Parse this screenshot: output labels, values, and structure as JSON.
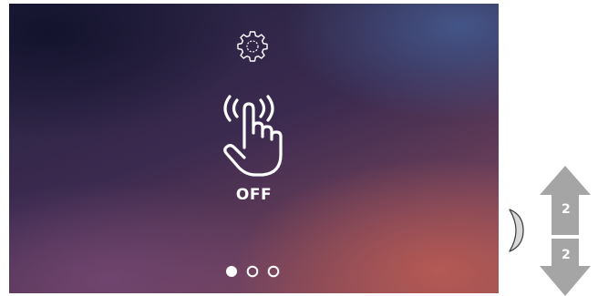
{
  "screen": {
    "status_label": "OFF",
    "icons": {
      "settings": "gear-icon",
      "function": "touch-hand-icon"
    },
    "pagination": {
      "total": 3,
      "active": 1
    }
  },
  "side_controls": {
    "up_label": "2",
    "down_label": "2",
    "arrow_color": "#a5a5a5"
  }
}
